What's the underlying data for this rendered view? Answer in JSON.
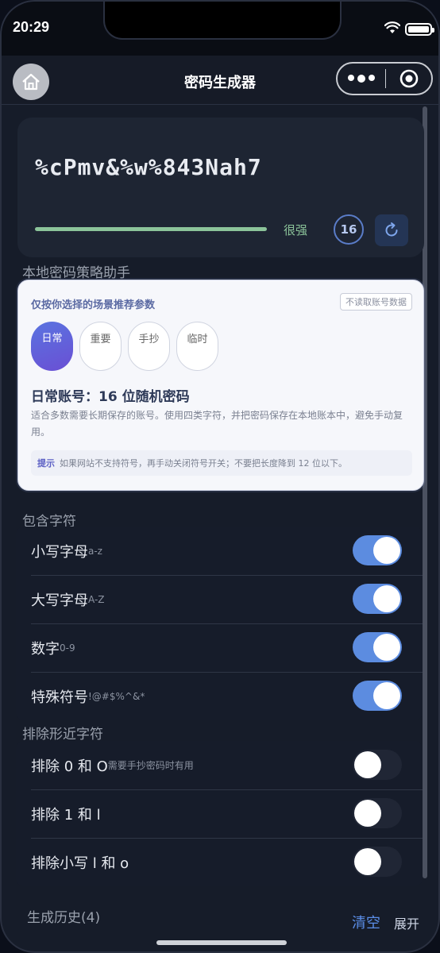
{
  "status": {
    "time": "20:29"
  },
  "nav": {
    "title": "密码生成器"
  },
  "password": {
    "value": "%cPmv&%w%843Nah7",
    "strength_label": "很强",
    "strength_level": 1.0,
    "length": "16"
  },
  "policy": {
    "section_title": "本地密码策略助手",
    "head": "仅按你选择的场景推荐参数",
    "tag": "不读取账号数据",
    "scenes": [
      "日常",
      "重要",
      "手抄",
      "临时"
    ],
    "selected_scene": "日常",
    "title": "日常账号：16 位随机密码",
    "desc": "适合多数需要长期保存的账号。使用四类字符，并把密码保存在本地账本中，避免手动复用。",
    "tip_label": "提示",
    "tip_text": "如果网站不支持符号，再手动关闭符号开关；不要把长度降到 12 位以下。"
  },
  "include": {
    "section_title": "包含字符",
    "items": [
      {
        "label": "小写字母",
        "hint": "a-z",
        "on": true
      },
      {
        "label": "大写字母",
        "hint": "A-Z",
        "on": true
      },
      {
        "label": "数字",
        "hint": "0-9",
        "on": true
      },
      {
        "label": "特殊符号",
        "hint": "!@#$%^&*",
        "on": true
      }
    ]
  },
  "exclude": {
    "section_title": "排除形近字符",
    "items": [
      {
        "label": "排除 0 和 O",
        "hint": "需要手抄密码时有用",
        "on": false
      },
      {
        "label": "排除 1 和 l",
        "hint": "",
        "on": false
      },
      {
        "label": "排除小写 l 和 o",
        "hint": "",
        "on": false
      }
    ]
  },
  "history": {
    "label": "生成历史(4)",
    "clear_label": "清空",
    "expand_label": "展开"
  },
  "colors": {
    "accent": "#5c8ce0",
    "strength": "#8cc49a",
    "scene_active": "#5a74e0"
  },
  "icons": [
    "home-icon",
    "more-dots-icon",
    "target-icon",
    "refresh-icon",
    "wifi-icon",
    "battery-icon"
  ]
}
